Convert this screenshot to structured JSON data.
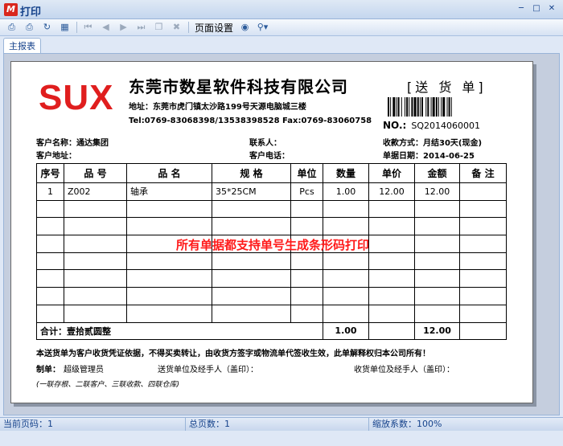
{
  "window": {
    "title": "打印",
    "logo": "M"
  },
  "toolbar": {
    "icons": [
      "print-icon",
      "print-preview-icon",
      "refresh-icon",
      "export-icon",
      "first-page-icon",
      "prev-page-icon",
      "next-page-icon",
      "last-page-icon",
      "copy-icon",
      "close-icon",
      "find-icon",
      "zoom-icon"
    ],
    "page_setup_label": "页面设置"
  },
  "tab": {
    "label": "主报表"
  },
  "report": {
    "logo": "SUX",
    "company": "东莞市数星软件科技有限公司",
    "doc_title": "[送 货 单]",
    "address": "地址：东莞市虎门镇太沙路199号天源电脑城三楼",
    "phone": "Tel:0769-83068398/13538398528   Fax:0769-83060758",
    "doc_no_label": "NO.:",
    "doc_no": "SQ2014060001",
    "customer_name": "客户名称：通达集团",
    "contact": "联系人：",
    "payment": "收款方式：月结30天(现金)",
    "customer_address": "客户地址：",
    "customer_phone": "客户电话：",
    "doc_date": "单据日期：2014-06-25",
    "headers": [
      "序号",
      "品 号",
      "品 名",
      "规 格",
      "单位",
      "数量",
      "单价",
      "金额",
      "备 注"
    ],
    "rows": [
      [
        "1",
        "Z002",
        "轴承",
        "35*25CM",
        "Pcs",
        "1.00",
        "12.00",
        "12.00",
        ""
      ]
    ],
    "total_label": "合计：壹拾贰圆整",
    "total_qty": "1.00",
    "total_amount": "12.00",
    "watermark": "所有单据都支持单号生成条形码打印",
    "note": "本送货单为客户收货凭证依据，不得买卖转让，由收货方签字或物流单代签收生效，此单解释权归本公司所有！",
    "maker": "制单：",
    "maker_name": "超级管理员",
    "sender": "送货单位及经手人（盖印）：",
    "receiver": "收货单位及经手人（盖印）：",
    "copies": "(一联存根、二联客户、三联收款、四联仓库)"
  },
  "status": {
    "current_page": "当前页码：1",
    "total_pages": "总页数：1",
    "zoom": "缩放系数：100%"
  }
}
